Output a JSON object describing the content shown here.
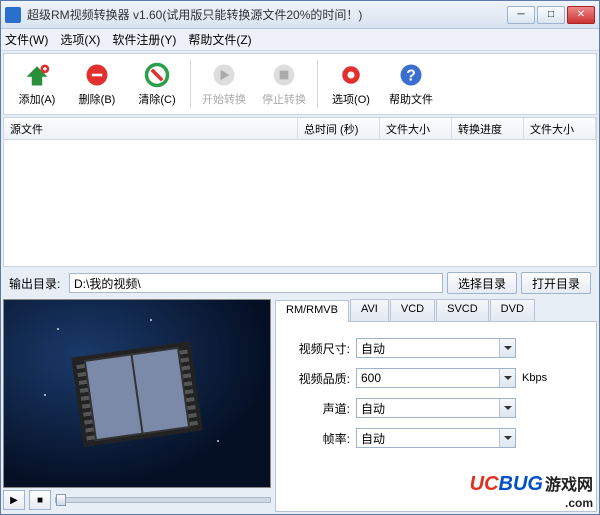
{
  "window": {
    "title": "超级RM视频转换器  v1.60(试用版只能转换源文件20%的时间！)"
  },
  "menubar": {
    "file": "文件(W)",
    "options": "选项(X)",
    "register": "软件注册(Y)",
    "help": "帮助文件(Z)"
  },
  "toolbar": {
    "add": "添加(A)",
    "remove": "删除(B)",
    "clear": "清除(C)",
    "start": "开始转换",
    "stop": "停止转换",
    "opts": "选项(O)",
    "helpfiles": "帮助文件"
  },
  "columns": {
    "source": "源文件",
    "duration": "总时间 (秒)",
    "filesize": "文件大小",
    "progress": "转换进度",
    "outsize": "文件大小"
  },
  "output": {
    "label": "输出目录:",
    "path": "D:\\我的视频\\",
    "browse": "选择目录",
    "open": "打开目录"
  },
  "tabs": {
    "rm": "RM/RMVB",
    "avi": "AVI",
    "vcd": "VCD",
    "svcd": "SVCD",
    "dvd": "DVD"
  },
  "fields": {
    "videosize_lbl": "视频尺寸:",
    "videosize_val": "自动",
    "quality_lbl": "视频品质:",
    "quality_val": "600",
    "quality_unit": "Kbps",
    "audio_lbl": "声道:",
    "audio_val": "自动",
    "fps_lbl": "帧率:",
    "fps_val": "自动"
  },
  "watermark": {
    "uc": "UC",
    "bug": "BUG",
    "txt": "游戏网",
    "com": ".com"
  }
}
